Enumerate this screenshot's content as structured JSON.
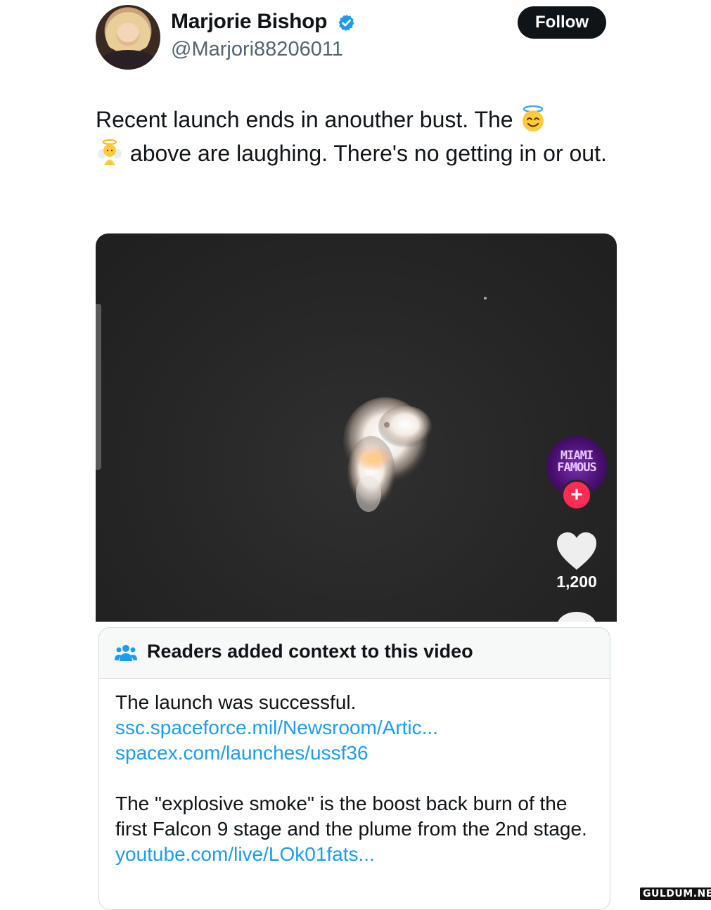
{
  "author": {
    "display_name": "Marjorie Bishop",
    "handle": "@Marjori88206011",
    "verified": true
  },
  "follow_label": "Follow",
  "tweet": {
    "text_part1": "Recent launch ends in anouther bust. The ",
    "text_part2": " above are laughing. There's no getting in or out.",
    "emojis": [
      "smiling-face-with-halo",
      "baby-angel"
    ]
  },
  "video": {
    "creator_overlay_text": "MIAMI FAMOUS",
    "like_count": "1,200",
    "follow_plus": "+"
  },
  "community_note": {
    "title": "Readers added context to this video",
    "paragraph1": "The launch was successful.",
    "link1": "ssc.spaceforce.mil/Newsroom/Artic...",
    "link2": "spacex.com/launches/ussf36",
    "paragraph2": "The \"explosive smoke\" is the boost back burn of the first Falcon 9 stage and the plume from the 2nd stage.",
    "link3": "youtube.com/live/LOk01fats..."
  },
  "watermark": "GULDUM.NET",
  "colors": {
    "link": "#1d9bf0",
    "verified": "#1d9bf0",
    "follow_bg": "#0f1419",
    "like_plus": "#fe2c55"
  }
}
